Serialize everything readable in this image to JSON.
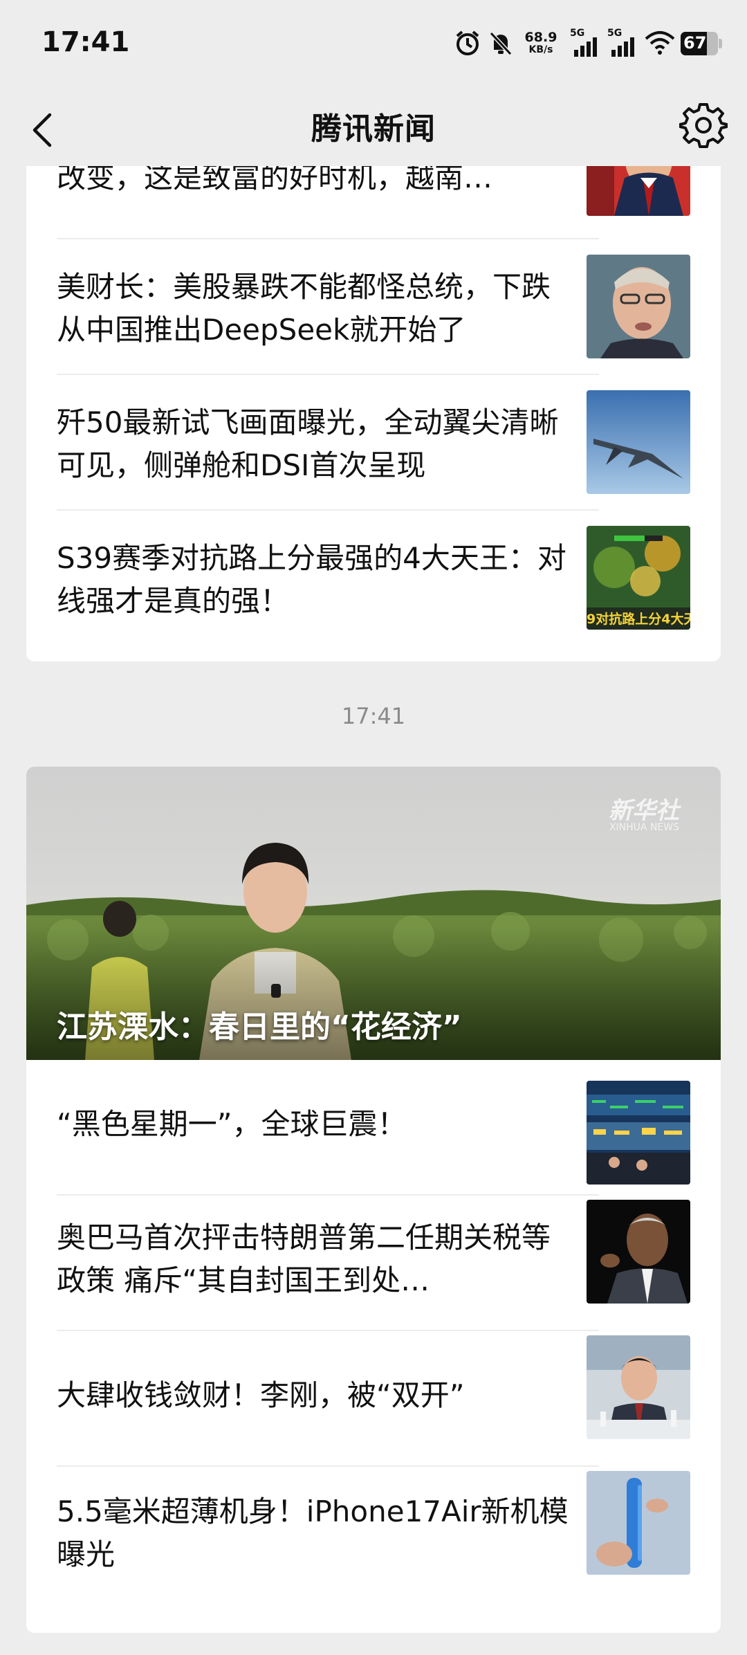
{
  "status_bar": {
    "time": "17:41",
    "net_speed_value": "68.9",
    "net_speed_unit": "KB/s",
    "signal1_label": "5G",
    "signal2_label": "5G",
    "battery": "67"
  },
  "nav": {
    "title": "腾讯新闻"
  },
  "feed1": {
    "items": [
      {
        "title": "改变，这是致富的好时机，越南…"
      },
      {
        "title": "美财长：美股暴跌不能都怪总统，下跌从中国推出DeepSeek就开始了"
      },
      {
        "title": "歼50最新试飞画面曝光，全动翼尖清晰可见，侧弹舱和DSI首次呈现"
      },
      {
        "title": "S39赛季对抗路上分最强的4大天王：对线强才是真的强！",
        "thumb_text": "9对抗路上分4大天"
      }
    ]
  },
  "timestamp": "17:41",
  "feed2": {
    "hero": {
      "title": "江苏溧水：春日里的“花经济”",
      "watermark": "新华社",
      "watermark_sub": "XINHUA NEWS"
    },
    "items": [
      {
        "title": "“黑色星期一”，全球巨震！"
      },
      {
        "title": "奥巴马首次抨击特朗普第二任期关税等政策 痛斥“其自封国王到处…"
      },
      {
        "title": "大肆收钱敛财！李刚，被“双开”"
      },
      {
        "title": "5.5毫米超薄机身！iPhone17Air新机模曝光"
      }
    ]
  },
  "colors": {
    "background": "#ededed",
    "card": "#ffffff",
    "text": "#111111",
    "timestamp": "#8a8a8a"
  }
}
